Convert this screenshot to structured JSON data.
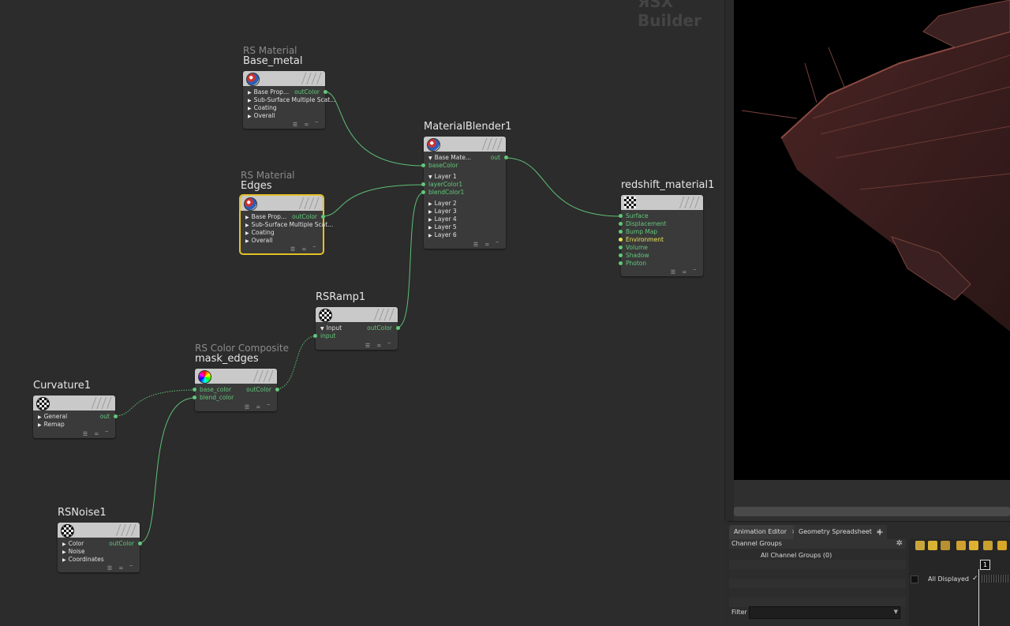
{
  "watermark": "ЯSX Builder",
  "nodes": {
    "base_metal": {
      "type": "RS Material",
      "name": "Base_metal",
      "rows": [
        "Base Prop...",
        "Sub-Surface Multiple Scat...",
        "Coating",
        "Overall"
      ],
      "out": "outColor"
    },
    "edges": {
      "type": "RS Material",
      "name": "Edges",
      "rows": [
        "Base Prop...",
        "Sub-Surface Multiple Scat...",
        "Coating",
        "Overall"
      ],
      "out": "outColor"
    },
    "blender": {
      "name": "MaterialBlender1",
      "base_group": "Base Mate...",
      "base_port": "baseColor",
      "layer1": "Layer 1",
      "layer1_ports": [
        "layerColor1",
        "blendColor1"
      ],
      "layers": [
        "Layer 2",
        "Layer 3",
        "Layer 4",
        "Layer 5",
        "Layer 6"
      ],
      "out": "out"
    },
    "rs_material": {
      "name": "redshift_material1",
      "ports": [
        "Surface",
        "Displacement",
        "Bump Map",
        "Environment",
        "Volume",
        "Shadow",
        "Photon"
      ]
    },
    "ramp": {
      "name": "RSRamp1",
      "group": "Input",
      "port": "input",
      "out": "outColor"
    },
    "composite": {
      "type": "RS Color Composite",
      "name": "mask_edges",
      "ports": [
        "base_color",
        "blend_color"
      ],
      "out": "outColor"
    },
    "curvature": {
      "name": "Curvature1",
      "rows": [
        "General",
        "Remap"
      ],
      "out": "out"
    },
    "noise": {
      "name": "RSNoise1",
      "rows": [
        "Color",
        "Noise",
        "Coordinates"
      ],
      "out": "outColor"
    }
  },
  "footer_glyphs": "☰ = ‾",
  "bottom": {
    "tabs": [
      {
        "label": "Animation Editor",
        "close": "×"
      },
      {
        "label": "Geometry Spreadsheet",
        "close": "×"
      }
    ],
    "add_tab": "+",
    "channel_groups": "Channel Groups",
    "all_groups": "All Channel Groups (0)",
    "filter": "Filter",
    "frame": "1",
    "all_displayed": "All Displayed",
    "check": "✓"
  },
  "colors": {
    "wire": "#5fbf78",
    "selected": "#e2c12a",
    "port": "#62c77a"
  }
}
